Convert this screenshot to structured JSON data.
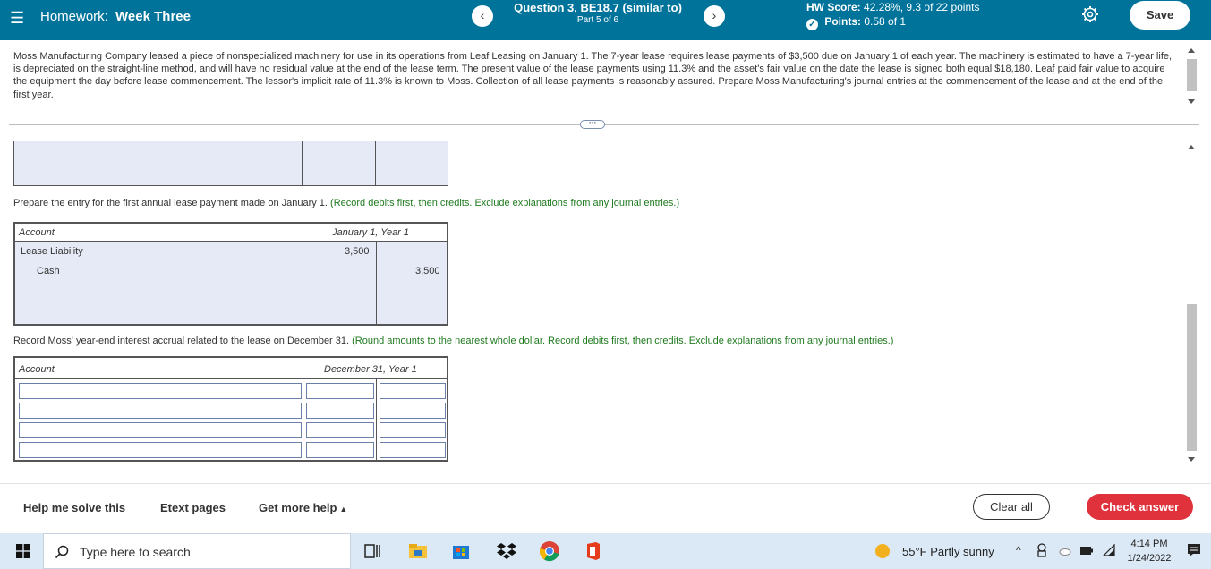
{
  "header": {
    "hw_prefix": "Homework:",
    "hw_name": "Week Three",
    "question_title": "Question 3, BE18.7 (similar to)",
    "question_part": "Part 5 of 6",
    "hw_score_label": "HW Score:",
    "hw_score_value": "42.28%, 9.3 of 22 points",
    "points_label": "Points:",
    "points_value": "0.58 of 1",
    "save_label": "Save",
    "prev_glyph": "‹",
    "next_glyph": "›"
  },
  "question": {
    "text": "Moss Manufacturing Company leased a piece of nonspecialized machinery for use in its operations from Leaf Leasing on January 1. The 7-year lease requires lease payments of $3,500 due on January 1 of each year. The machinery is estimated to have a 7-year life, is depreciated on the straight-line method, and will have no residual value at the end of the lease term. The present value of the lease payments using 11.3% and the asset's fair value on the date the lease is signed both equal $18,180. Leaf paid fair value to acquire the equipment the day before lease commencement. The lessor's implicit rate of 11.3% is known to Moss. Collection of all lease payments is reasonably assured. Prepare Moss Manufacturing's journal entries at the commencement of the lease and at the end of the first year."
  },
  "part1": {
    "instruction": "Prepare the entry for the first annual lease payment made on January 1.",
    "hint": "(Record debits first, then credits. Exclude explanations from any journal entries.)",
    "header_account": "Account",
    "header_date": "January 1, Year 1",
    "rows": [
      {
        "account": "Lease Liability",
        "debit": "3,500",
        "credit": ""
      },
      {
        "account": "Cash",
        "debit": "",
        "credit": "3,500"
      }
    ]
  },
  "part2": {
    "instruction": "Record Moss' year-end interest accrual related to the lease on December 31.",
    "hint": "(Round amounts to the nearest whole dollar. Record debits first, then credits. Exclude explanations from any journal entries.)",
    "header_account": "Account",
    "header_date": "December 31, Year 1"
  },
  "footer": {
    "help_label": "Help me solve this",
    "etext_label": "Etext pages",
    "more_help_label": "Get more help",
    "clear_label": "Clear all",
    "check_label": "Check answer"
  },
  "taskbar": {
    "search_placeholder": "Type here to search",
    "weather": "55°F  Partly sunny",
    "time": "4:14 PM",
    "date": "1/24/2022"
  },
  "colors": {
    "header_bg": "#00739b",
    "check_answer_bg": "#e0323d",
    "table_fill": "#e6eaf6",
    "hint_green": "#1f7a1f"
  }
}
